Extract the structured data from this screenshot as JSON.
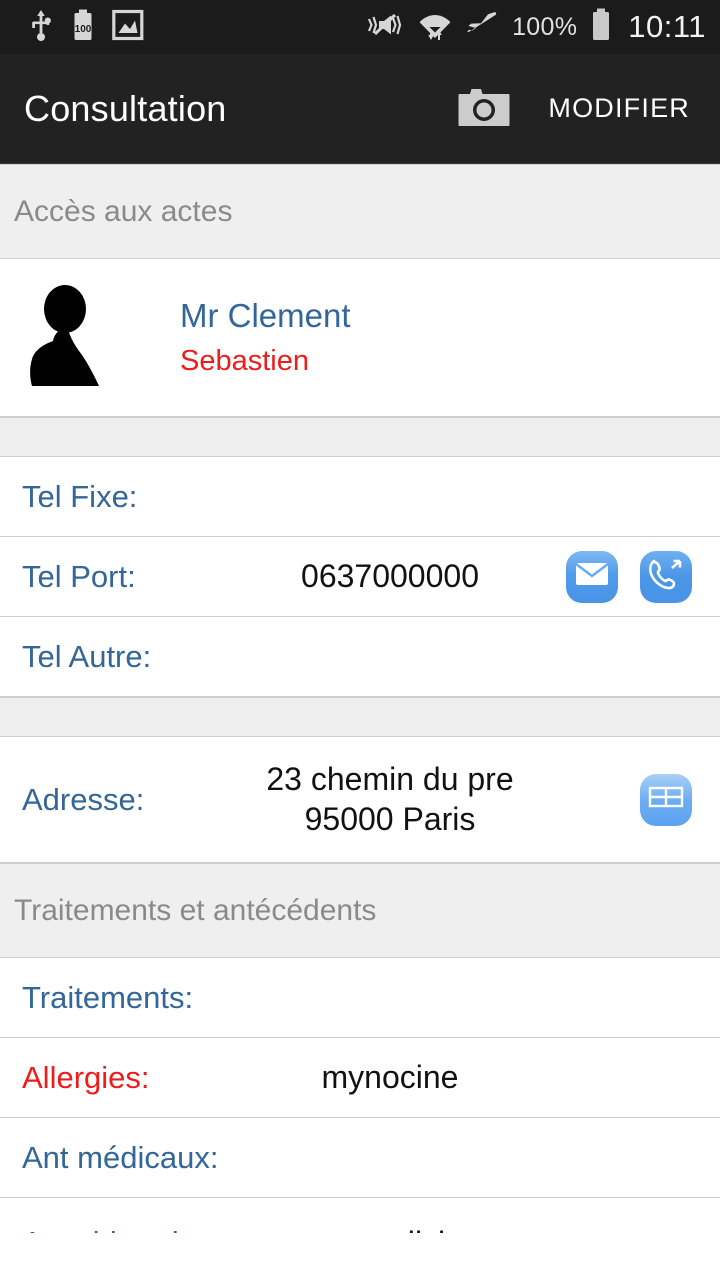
{
  "statusbar": {
    "left_icons": [
      "usb-icon",
      "battery-100-icon",
      "image-icon"
    ],
    "battery_inline_text": "100",
    "right_icons": [
      "vibrate-mute-icon",
      "wifi-transfer-icon",
      "airplane-mode-icon",
      "battery-icon"
    ],
    "battery_percent": "100%",
    "clock": "10:11"
  },
  "appbar": {
    "title": "Consultation",
    "camera_icon": "camera-icon",
    "edit_label": "MODIFIER"
  },
  "sections": {
    "actes_header": "Accès aux actes",
    "traitements_header": "Traitements et antécédents"
  },
  "patient": {
    "avatar_icon": "person-silhouette-icon",
    "name": "Mr Clement",
    "firstname": "Sebastien"
  },
  "contact": {
    "tel_fixe_label": "Tel Fixe:",
    "tel_fixe_value": "",
    "tel_port_label": "Tel Port:",
    "tel_port_value": "0637000000",
    "tel_port_actions": [
      "sms-icon",
      "call-icon"
    ],
    "tel_autre_label": "Tel Autre:",
    "tel_autre_value": "",
    "adresse_label": "Adresse:",
    "adresse_line1": "23 chemin du pre",
    "adresse_line2": "95000 Paris",
    "adresse_action": "map-icon"
  },
  "medical": {
    "traitements_label": "Traitements:",
    "traitements_value": "",
    "allergies_label": "Allergies:",
    "allergies_value": "mynocine",
    "ant_medicaux_label": "Ant médicaux:",
    "ant_medicaux_value": "",
    "ant_chirurgicaux_label": "Ant chirurgicaux:",
    "ant_chirurgicaux_value": "appendicite"
  },
  "colors": {
    "accent_blue": "#336699",
    "alert_red": "#ee1c1c",
    "appbar_bg": "#222222",
    "statusbar_bg": "#1b1b1b",
    "section_bg": "#efefef",
    "icon_blue": "#4a93e8"
  }
}
